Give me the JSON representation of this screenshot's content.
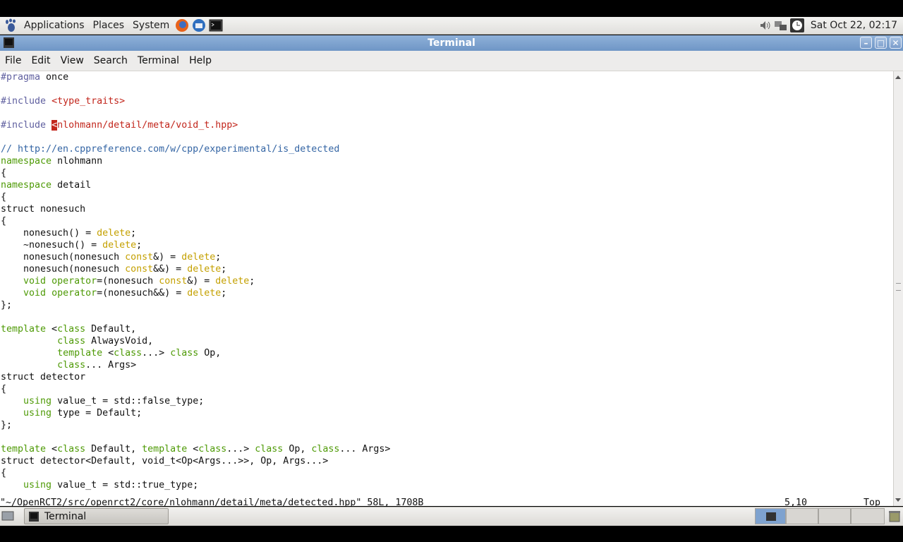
{
  "panel": {
    "menus": [
      "Applications",
      "Places",
      "System"
    ],
    "clock": "Sat Oct 22, 02:17"
  },
  "window": {
    "title": "Terminal",
    "menu": [
      "File",
      "Edit",
      "View",
      "Search",
      "Terminal",
      "Help"
    ]
  },
  "editor": {
    "lines": [
      "#pragma once",
      "",
      "#include <type_traits>",
      "",
      "#include <nlohmann/detail/meta/void_t.hpp>",
      "",
      "// http://en.cppreference.com/w/cpp/experimental/is_detected",
      "namespace nlohmann",
      "{",
      "namespace detail",
      "{",
      "struct nonesuch",
      "{",
      "    nonesuch() = delete;",
      "    ~nonesuch() = delete;",
      "    nonesuch(nonesuch const&) = delete;",
      "    nonesuch(nonesuch const&&) = delete;",
      "    void operator=(nonesuch const&) = delete;",
      "    void operator=(nonesuch&&) = delete;",
      "};",
      "",
      "template <class Default,",
      "          class AlwaysVoid,",
      "          template <class...> class Op,",
      "          class... Args>",
      "struct detector",
      "{",
      "    using value_t = std::false_type;",
      "    using type = Default;",
      "};",
      "",
      "template <class Default, template <class...> class Op, class... Args>",
      "struct detector<Default, void_t<Op<Args...>>, Op, Args...>",
      "{",
      "    using value_t = std::true_type;"
    ],
    "status_file": "\"~/OpenRCT2/src/openrct2/core/nlohmann/detail/meta/detected.hpp\" 58L, 1708B",
    "status_pos": "5,10",
    "status_scroll": "Top"
  },
  "taskbar": {
    "task_label": "Terminal"
  },
  "colors": {
    "keyword": "#4e9a06",
    "header": "#c2261c",
    "comment": "#3465a4",
    "delete": "#c4a000",
    "titlebar": "#7a9ccb"
  }
}
